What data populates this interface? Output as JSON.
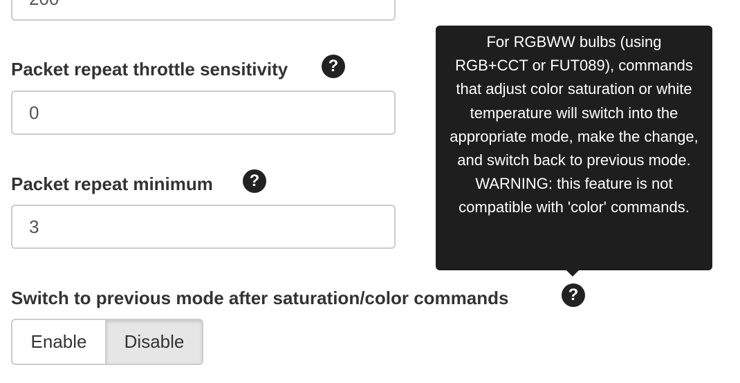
{
  "fields": {
    "top_value": "200",
    "throttle": {
      "label": "Packet repeat throttle sensitivity",
      "value": "0",
      "help_icon": "question-circle-icon"
    },
    "minimum": {
      "label": "Packet repeat minimum",
      "value": "3",
      "help_icon": "question-circle-icon"
    },
    "switch_mode": {
      "label": "Switch to previous mode after saturation/color commands",
      "help_icon": "question-circle-icon",
      "options": [
        "Enable",
        "Disable"
      ],
      "selected": "Disable"
    }
  },
  "tooltip": {
    "text": "For RGBWW bulbs (using RGB+CCT or FUT089), commands that adjust color saturation or white temperature will switch into the appropriate mode, make the change, and switch back to previous mode. WARNING: this feature is not compatible with 'color' commands."
  },
  "colors": {
    "tooltip_bg": "#1e1e1e",
    "icon_bg": "#222222",
    "input_border": "#cccccc",
    "active_button_bg": "#e6e6e6"
  }
}
